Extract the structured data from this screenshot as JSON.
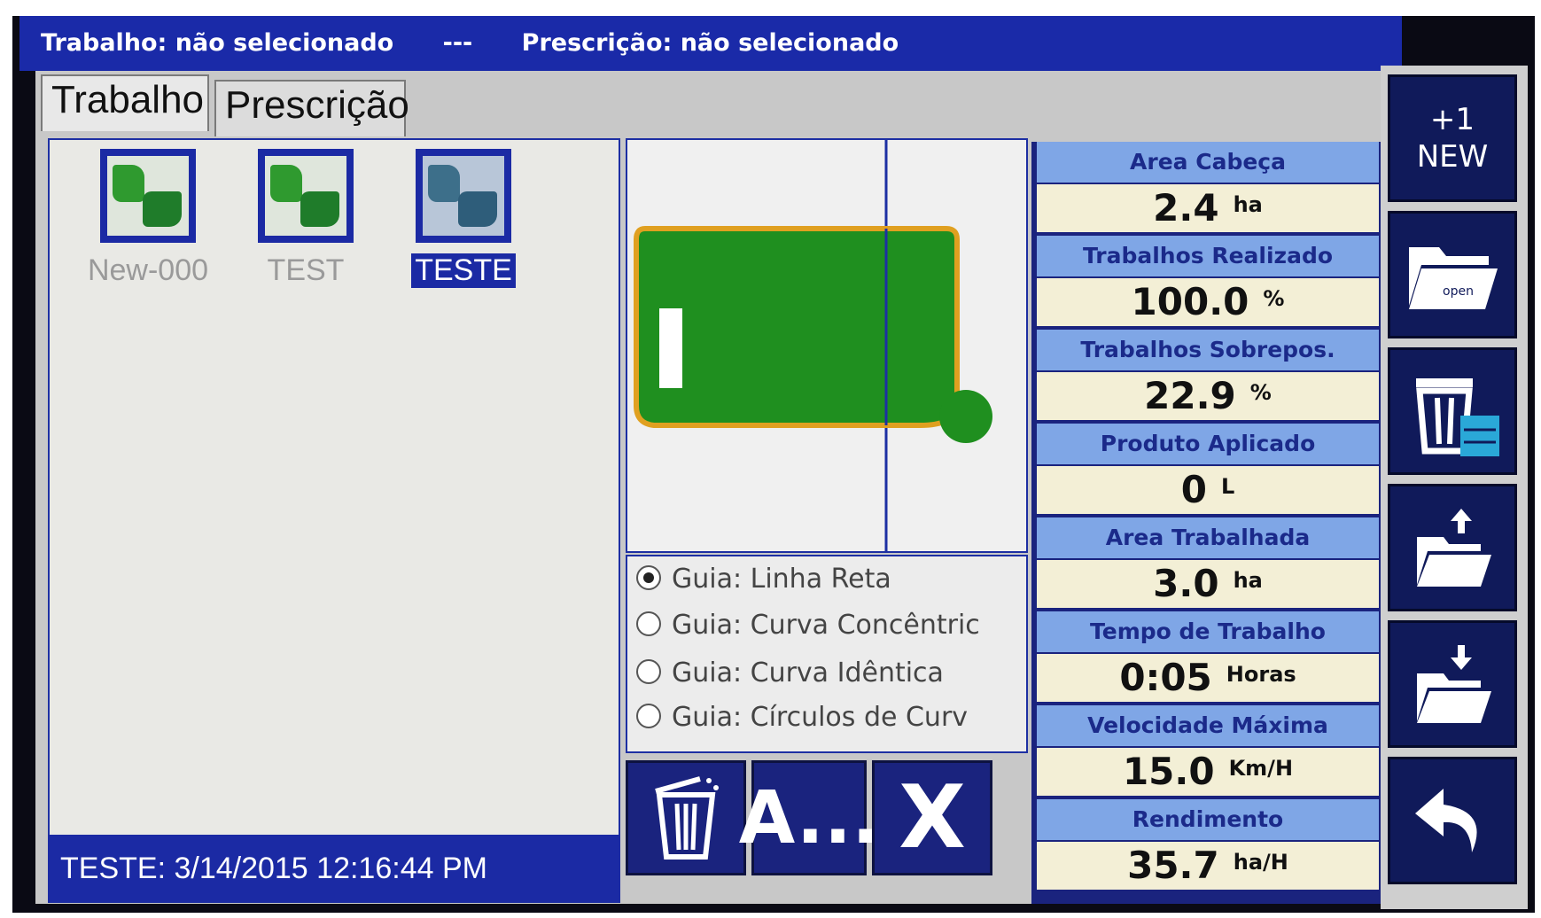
{
  "topbar": {
    "job": "Trabalho: não selecionado",
    "separator": "---",
    "prescription": "Prescrição: não selecionado"
  },
  "tabs": [
    {
      "label": "Trabalho",
      "active": true
    },
    {
      "label": "Prescrição",
      "active": false
    }
  ],
  "jobs": [
    {
      "label": "New-000",
      "selected": false
    },
    {
      "label": "TEST",
      "selected": false
    },
    {
      "label": "TESTE",
      "selected": true
    }
  ],
  "job_status": "TESTE: 3/14/2015 12:16:44 PM",
  "guides": [
    {
      "label": "Guia: Linha Reta",
      "selected": true
    },
    {
      "label": "Guia: Curva Concêntric",
      "selected": false
    },
    {
      "label": "Guia: Curva Idêntica",
      "selected": false
    },
    {
      "label": "Guia: Círculos de Curv",
      "selected": false
    }
  ],
  "actions": {
    "delete_icon": "trash-icon",
    "rename_label": "A...",
    "close_label": "X"
  },
  "stats": [
    {
      "title": "Area Cabeça",
      "value": "2.4",
      "unit": "ha"
    },
    {
      "title": "Trabalhos Realizado",
      "value": "100.0",
      "unit": "%"
    },
    {
      "title": "Trabalhos Sobrepos.",
      "value": "22.9",
      "unit": "%"
    },
    {
      "title": "Produto Aplicado",
      "value": "0",
      "unit": "L"
    },
    {
      "title": "Area Trabalhada",
      "value": "3.0",
      "unit": "ha"
    },
    {
      "title": "Tempo de Trabalho",
      "value": "0:05",
      "unit": "Horas"
    },
    {
      "title": "Velocidade Máxima",
      "value": "15.0",
      "unit": "Km/H"
    },
    {
      "title": "Rendimento",
      "value": "35.7",
      "unit": "ha/H"
    }
  ],
  "tools": {
    "new_line1": "+1",
    "new_line2": "NEW",
    "open_label": "open",
    "icons": [
      "new-job-icon",
      "open-folder-icon",
      "delete-job-icon",
      "export-folder-icon",
      "import-folder-icon",
      "back-arrow-icon"
    ]
  },
  "colors": {
    "bar_blue": "#1b2aa4",
    "stat_header": "#7fa6e6",
    "stat_value_bg": "#f3efd6",
    "field_green": "#1f8f1f",
    "field_border": "#e0a020"
  }
}
